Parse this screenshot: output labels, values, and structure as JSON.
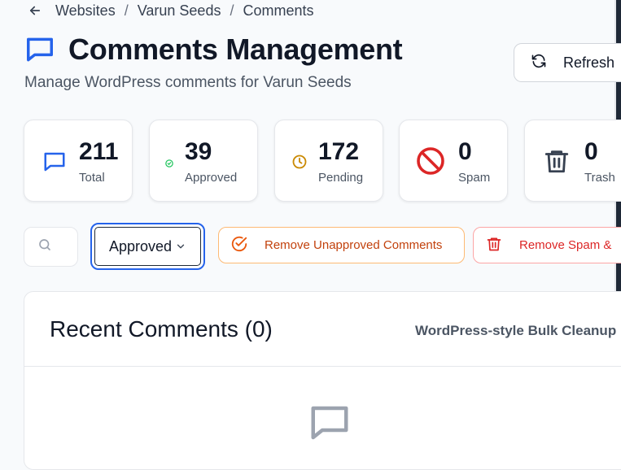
{
  "breadcrumb": {
    "items": [
      "Websites",
      "Varun Seeds",
      "Comments"
    ],
    "separator": "/"
  },
  "header": {
    "title": "Comments Management",
    "subtitle": "Manage WordPress comments for Varun Seeds",
    "refresh_label": "Refresh"
  },
  "stats": [
    {
      "value": "211",
      "label": "Total",
      "icon": "comment-icon",
      "color": "#2563eb"
    },
    {
      "value": "39",
      "label": "Approved",
      "icon": "check-circle-icon",
      "color": "#22c55e"
    },
    {
      "value": "172",
      "label": "Pending",
      "icon": "clock-icon",
      "color": "#ca8a04"
    },
    {
      "value": "0",
      "label": "Spam",
      "icon": "ban-icon",
      "color": "#dc2626"
    },
    {
      "value": "0",
      "label": "Trash",
      "icon": "trash-icon",
      "color": "#374151"
    }
  ],
  "filters": {
    "status_selected": "Approved",
    "remove_unapproved_label": "Remove Unapproved Comments",
    "remove_spam_label": "Remove Spam &"
  },
  "panel": {
    "title": "Recent Comments (0)",
    "right_label": "WordPress-style Bulk Cleanup"
  },
  "colors": {
    "accent": "#2563eb",
    "warning_orange": "#c2410c",
    "danger_red": "#dc2626"
  }
}
